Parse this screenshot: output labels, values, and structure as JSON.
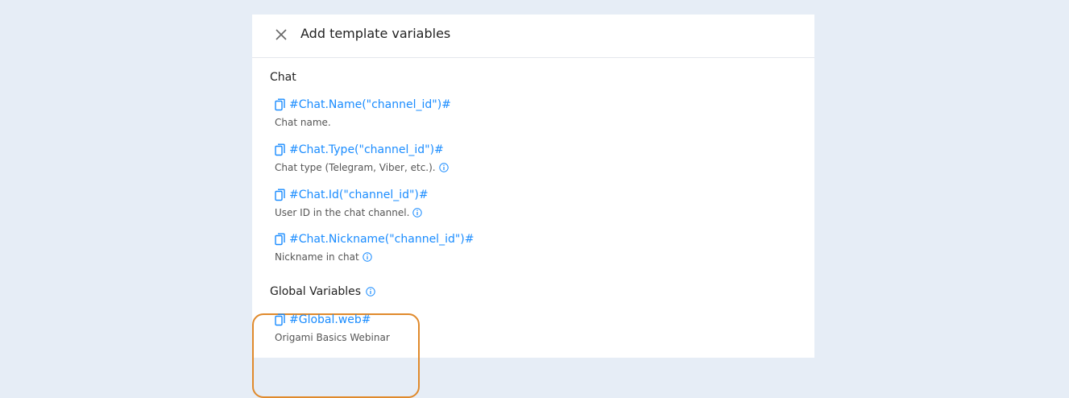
{
  "dialog": {
    "title": "Add template variables"
  },
  "sections": [
    {
      "title": "Chat",
      "items": [
        {
          "variable": "#Chat.Name(\"channel_id\")#",
          "description": "Chat name.",
          "info": false
        },
        {
          "variable": "#Chat.Type(\"channel_id\")#",
          "description": "Chat type (Telegram, Viber, etc.).",
          "info": true
        },
        {
          "variable": "#Chat.Id(\"channel_id\")#",
          "description": "User ID in the chat channel.",
          "info": true
        },
        {
          "variable": "#Chat.Nickname(\"channel_id\")#",
          "description": "Nickname in chat",
          "info": true
        }
      ]
    },
    {
      "title": "Global Variables",
      "items": [
        {
          "variable": "#Global.web#",
          "description": "Origami Basics Webinar",
          "info": false
        }
      ]
    }
  ],
  "colors": {
    "link": "#1a8cff",
    "highlight": "#e08a2c"
  },
  "icons": {
    "close": "close-icon",
    "copy": "copy-icon",
    "info": "info-icon"
  }
}
